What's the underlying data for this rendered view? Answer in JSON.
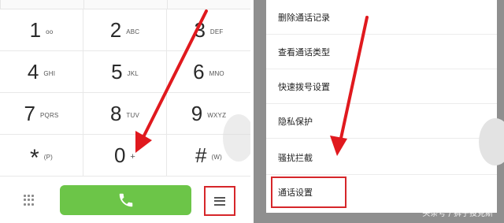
{
  "dialer": {
    "keys": [
      {
        "digit": "1",
        "letters": "oo"
      },
      {
        "digit": "2",
        "letters": "ABC"
      },
      {
        "digit": "3",
        "letters": "DEF"
      },
      {
        "digit": "4",
        "letters": "GHI"
      },
      {
        "digit": "5",
        "letters": "JKL"
      },
      {
        "digit": "6",
        "letters": "MNO"
      },
      {
        "digit": "7",
        "letters": "PQRS"
      },
      {
        "digit": "8",
        "letters": "TUV"
      },
      {
        "digit": "9",
        "letters": "WXYZ"
      },
      {
        "digit": "*",
        "letters": "(P)"
      },
      {
        "digit": "0",
        "letters": "+"
      },
      {
        "digit": "#",
        "letters": "(W)"
      }
    ]
  },
  "menu": {
    "items": [
      "删除通话记录",
      "查看通话类型",
      "快速拨号设置",
      "隐私保护",
      "骚扰拦截",
      "通话设置"
    ]
  },
  "watermark": "头条号 / 狮子投克斯",
  "colors": {
    "call_green": "#6cc548",
    "highlight_red": "#d6262a",
    "arrow_red": "#e0191e",
    "overlay_gray": "#8f8f8f"
  },
  "icons": {
    "call": "phone-icon",
    "dialpad": "dialpad-dots-icon",
    "menu": "hamburger-menu-icon"
  }
}
